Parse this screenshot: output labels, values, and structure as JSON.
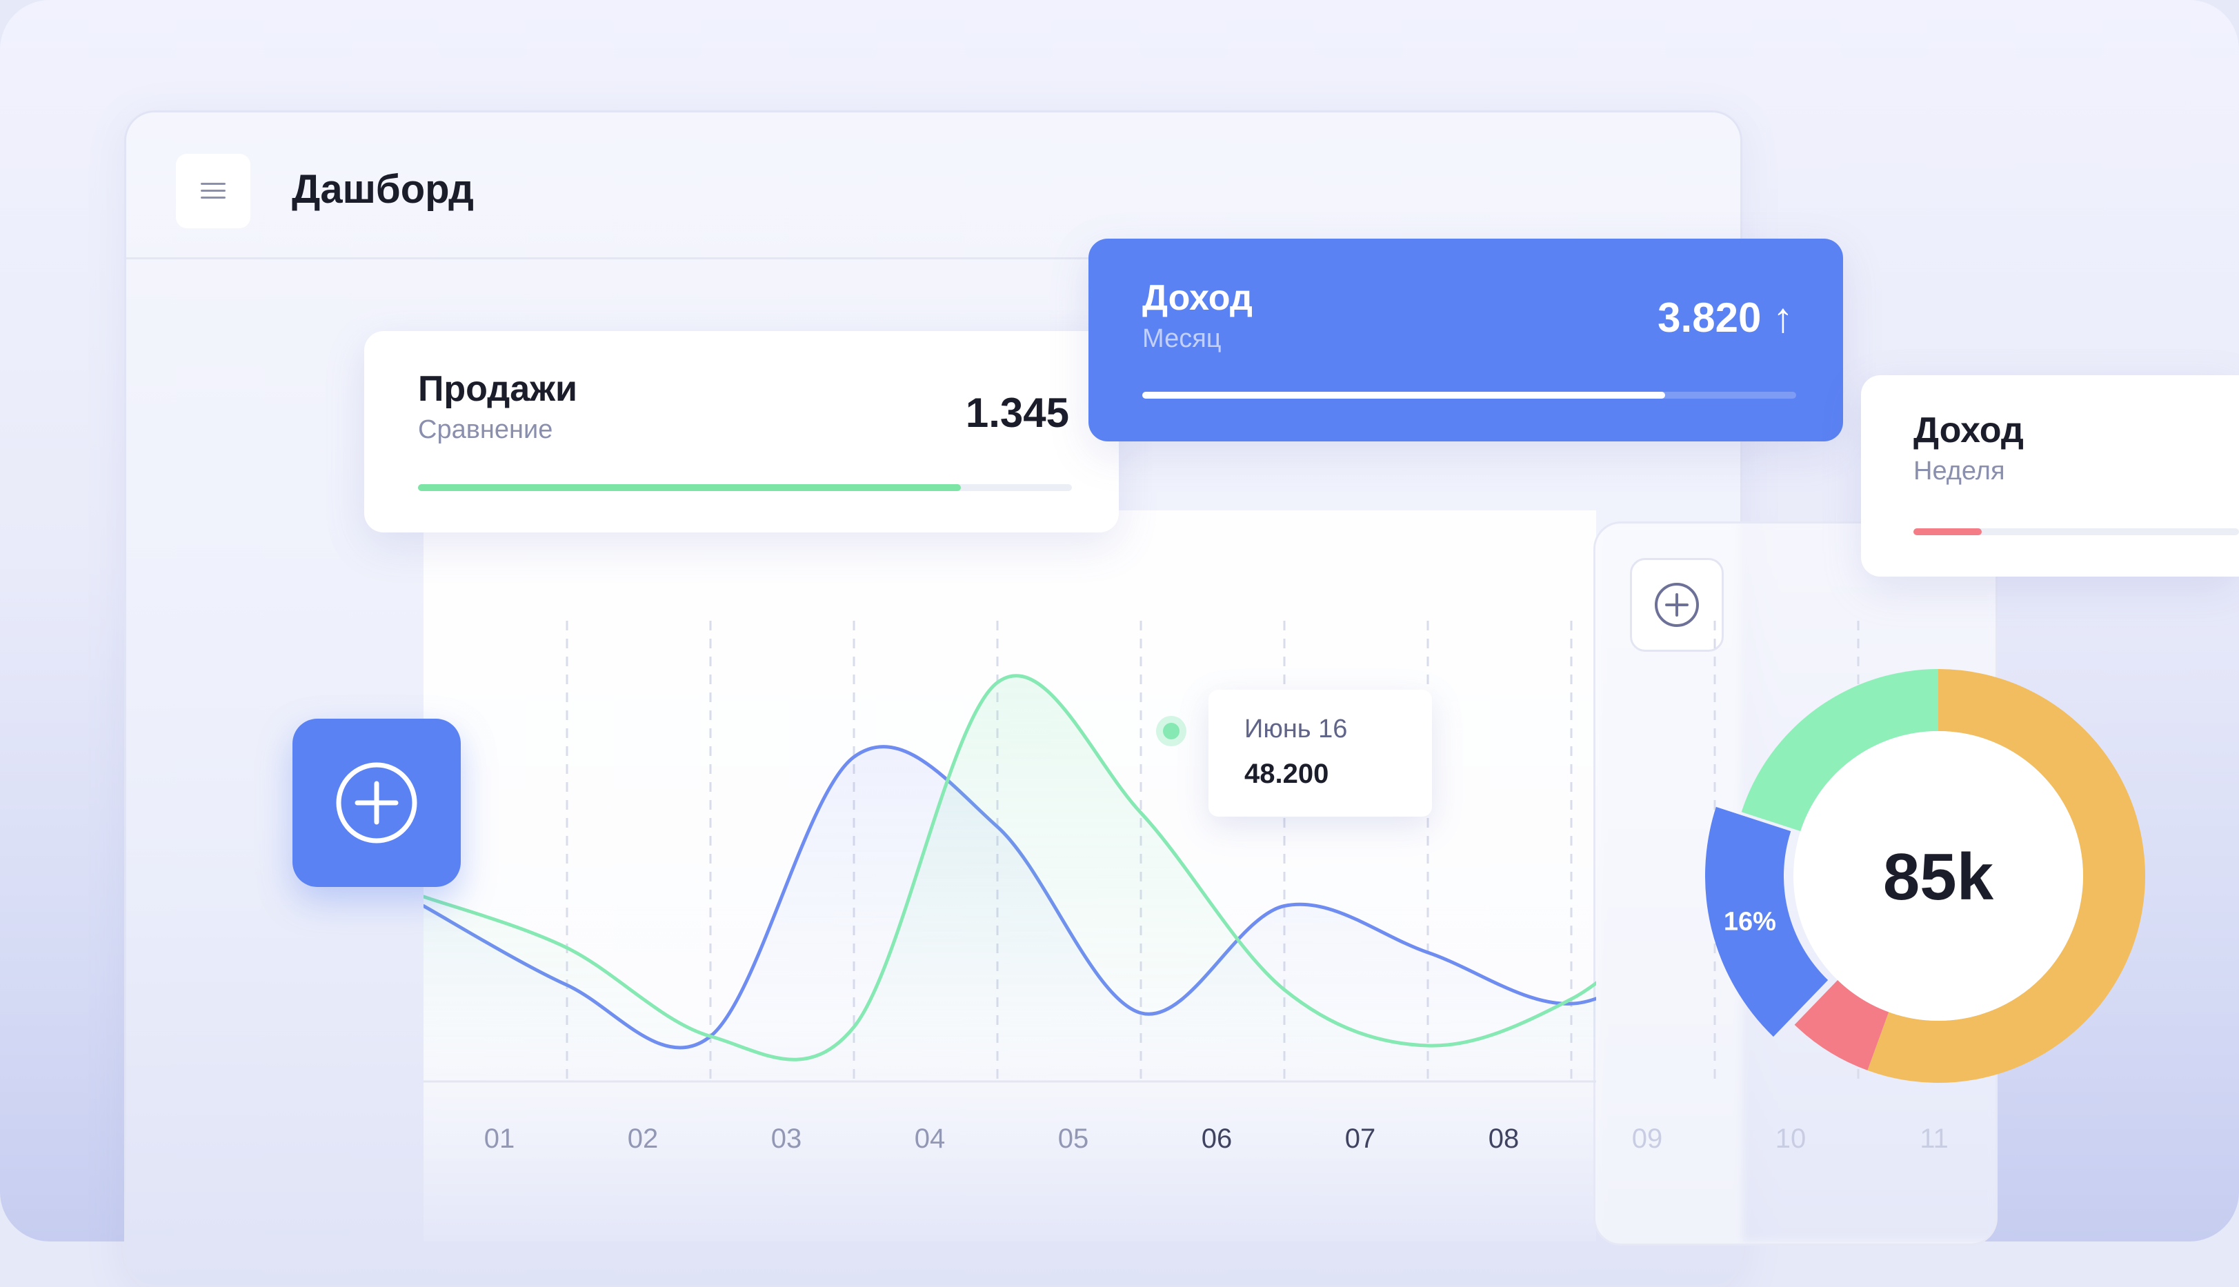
{
  "header": {
    "title": "Дашборд",
    "menu_icon": "hamburger-menu-icon"
  },
  "cards": {
    "sales": {
      "title": "Продажи",
      "subtitle": "Сравнение",
      "value": "1.345",
      "progress": 0.83,
      "color": "#7ce4a4"
    },
    "income_month": {
      "title": "Доход",
      "subtitle": "Месяц",
      "value": "3.820 ↑",
      "progress": 0.8,
      "color": "#ffffff"
    },
    "income_week": {
      "title": "Доход",
      "subtitle": "Неделя",
      "progress": 0.21,
      "color": "#f47c86"
    }
  },
  "tooltip": {
    "date": "Июнь 16",
    "value": "48.200"
  },
  "colors": {
    "accent": "#5b82f2",
    "green": "#7ce4a4",
    "red": "#f47c86",
    "orange": "#f2bd5e"
  },
  "chart_data": [
    {
      "type": "line",
      "categories": [
        "01",
        "02",
        "03",
        "04",
        "05",
        "06",
        "07",
        "08",
        "09",
        "10",
        "11"
      ],
      "highlighted_category": "06",
      "series": [
        {
          "color": "#6f8cf0",
          "values": [
            38,
            21,
            10,
            70,
            55,
            15,
            38,
            28,
            17,
            30,
            22
          ]
        },
        {
          "color": "#86e8b2",
          "values": [
            40,
            29,
            10,
            12,
            86,
            58,
            20,
            8,
            18,
            40,
            35
          ]
        }
      ],
      "ylim": [
        0,
        100
      ],
      "grid": "vertical-dashed"
    },
    {
      "type": "pie",
      "center_label": "85k",
      "slices": [
        {
          "value": 50,
          "color": "#f2bd5e"
        },
        {
          "value": 6,
          "color": "#f47c86"
        },
        {
          "value": 16,
          "label": "16%",
          "color": "#5b82f2"
        },
        {
          "value": 18,
          "color": "#8ef0b8"
        }
      ]
    }
  ]
}
